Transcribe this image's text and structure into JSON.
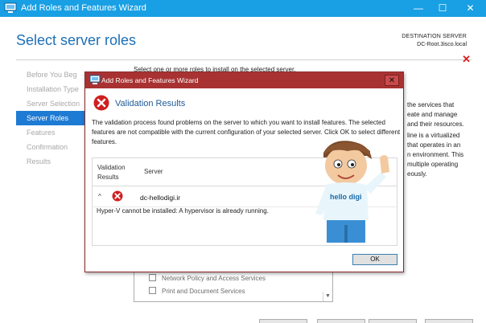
{
  "window": {
    "title": "Add Roles and Features Wizard",
    "minimize": "—",
    "maximize": "☐",
    "close": "✕"
  },
  "header": {
    "page_title": "Select server roles",
    "destination_label": "DESTINATION SERVER",
    "destination_server": "DC-Root.3isco.local"
  },
  "nav": {
    "items": [
      {
        "label": "Before You Beg"
      },
      {
        "label": "Installation Type"
      },
      {
        "label": "Server Selection"
      },
      {
        "label": "Server Roles"
      },
      {
        "label": "Features"
      },
      {
        "label": "Confirmation"
      },
      {
        "label": "Results"
      }
    ],
    "active_index": 3
  },
  "main": {
    "intro": "Select one or more roles to install on the selected server.",
    "description_fragments": [
      "the services that",
      "eate and manage",
      "and their resources.",
      "line is a virtualized",
      "that operates in an",
      "n environment. This",
      "multiple operating",
      "eously."
    ],
    "roles": [
      {
        "label": "Network Policy and Access Services",
        "checked": false
      },
      {
        "label": "Print and Document Services",
        "checked": false
      }
    ]
  },
  "dialog": {
    "title": "Add Roles and Features Wizard",
    "close": "✕",
    "heading": "Validation Results",
    "message": "The validation process found problems on the server to which you want to install features. The selected features are not compatible with the current configuration of your selected server.  Click OK to select different features.",
    "col_validation_line1": "Validation",
    "col_validation_line2": "Results",
    "col_server": "Server",
    "collapse_glyph": "^",
    "server_name": "dc-hellodigi.ir",
    "issue": "Hyper-V cannot be installed: A hypervisor is already running.",
    "ok_label": "OK"
  },
  "watermark": {
    "text": "hello digi"
  },
  "colors": {
    "titlebar": "#19a0e4",
    "dialog_titlebar": "#a83232",
    "accent": "#1e7bd4",
    "heading": "#1e6fb6",
    "error": "#d81e1e"
  },
  "icons": {
    "app": "server-manager-icon",
    "error": "error-x-icon",
    "collapse": "chevron-up-icon",
    "cancel": "red-x-icon"
  }
}
